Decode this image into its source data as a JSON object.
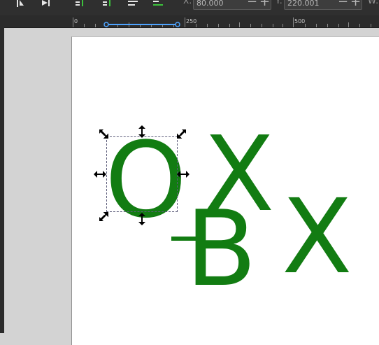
{
  "toolbar": {
    "x_label": "X:",
    "x_value": "80.000",
    "y_label": "Y:",
    "y_value": "220.001",
    "w_label": "W:",
    "minus": "−",
    "plus": "+"
  },
  "ruler": {
    "ticks": [
      "0",
      "250",
      "500"
    ]
  },
  "canvas": {
    "glyph_color": "#127c12",
    "objects": [
      {
        "char": "O",
        "selected": true
      },
      {
        "char": "X"
      },
      {
        "char": "B"
      },
      {
        "char": "X"
      }
    ]
  },
  "colors": {
    "toolbar_bg": "#2f2f2f",
    "accent_blue": "#4da3ff",
    "page_bg": "#ffffff",
    "desk_bg": "#d3d3d3"
  }
}
